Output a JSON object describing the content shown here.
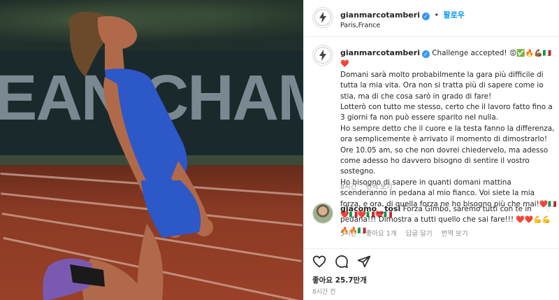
{
  "post": {
    "username": "gianmarcotamberi",
    "follow_label": "팔로우",
    "location": "Paris,France",
    "photo_banner_text": "EAN CHAMPION"
  },
  "caption": {
    "username": "gianmarcotamberi",
    "first_line": "Challenge accepted!",
    "first_line_emoji": "😡✅🔥💪🏾🇮🇹❤️",
    "paragraphs": [
      "Domani sarà molto probabilmente la gara più difficile di tutta la mia vita. Ora non si tratta più di sapere come io stia, ma di che cosa sarò in grado di fare!",
      "Lotterò con tutto me stesso, certo che il lavoro fatto fino a 3 giorni fa non può essere sparito nel nulla.",
      "Ho sempre detto che il cuore e la testa fanno la differenza, ora semplicemente è arrivato il momento di dimostrarlo!",
      "Ore 10.05 am, so che non dovrei chiedervelo, ma adesso come adesso ho davvero bisogno di sentire il vostro sostegno.",
      "Ho bisogno di sapere in quanti domani mattina scenderanno in pedana al mio fianco. Voi siete la mia forza, e ora, di quella forza ne ho bisogno più che mai!"
    ],
    "tail_emoji": "❤️🇮🇹❤️🇮🇹❤️🇮🇹❤️🇮🇹",
    "time": "8시간",
    "translate": "번역 보기"
  },
  "comment": {
    "username": "giacomo__tosi",
    "text": "Forza Gimbo, saremo tutti con te in pedana!!! Dimostra a tutti quello che sai fare!!!",
    "emoji": "❤️❤️💪💪🔥🔥🇮🇹",
    "time": "5시간",
    "likes": "좋아요 1개",
    "reply": "답글 달기",
    "translate": "번역 보기"
  },
  "actions": {
    "like_icon": "heart-icon",
    "comment_icon": "comment-icon",
    "share_icon": "share-icon"
  },
  "stats": {
    "likes": "좋아요 25.7만개",
    "posted": "8시간 전"
  },
  "colors": {
    "accent": "#0095f6",
    "verified": "#3897f0",
    "muted": "#8e8e8e",
    "heart": "#ed4956"
  }
}
